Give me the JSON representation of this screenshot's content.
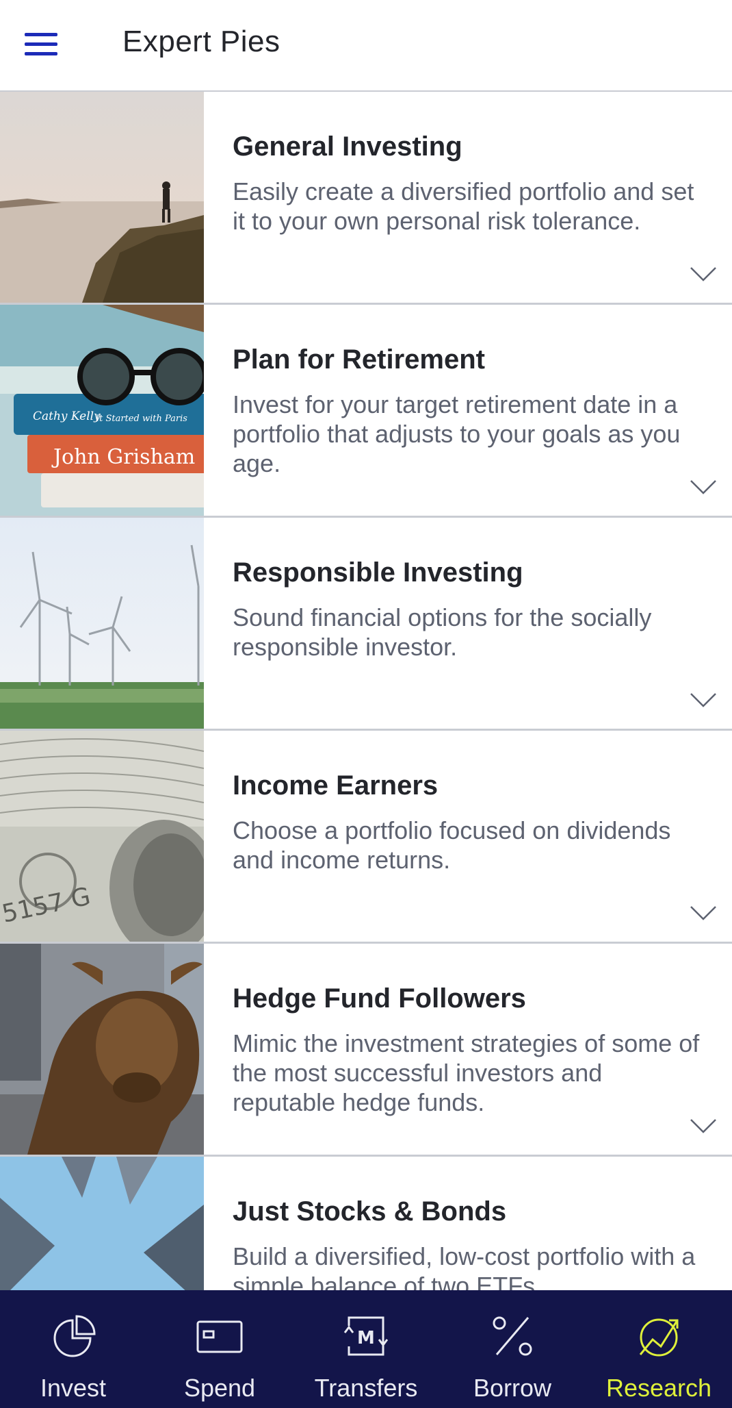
{
  "header": {
    "title": "Expert Pies"
  },
  "pies": [
    {
      "title": "General Investing",
      "description": "Easily create a diversified portfolio and set it to your own personal risk tolerance."
    },
    {
      "title": "Plan for Retirement",
      "description": "Invest for your target retirement date in a portfolio that adjusts to your goals as you age."
    },
    {
      "title": "Responsible Investing",
      "description": "Sound financial options for the socially responsible investor."
    },
    {
      "title": "Income Earners",
      "description": "Choose a portfolio focused on dividends and income returns."
    },
    {
      "title": "Hedge Fund Followers",
      "description": "Mimic the investment strategies of some of the most successful investors and reputable hedge funds."
    },
    {
      "title": "Just Stocks & Bonds",
      "description": "Build a diversified, low-cost portfolio with a simple balance of two ETFs."
    }
  ],
  "images": [
    {
      "icon": "hiker-on-cliff-image",
      "text": []
    },
    {
      "icon": "books-and-sunglasses-image",
      "text": [
        "Cathy Kelly",
        "It Started with Paris",
        "John Grisham"
      ]
    },
    {
      "icon": "wind-turbines-image",
      "text": []
    },
    {
      "icon": "dollar-bills-image",
      "text": [
        "5157 G"
      ]
    },
    {
      "icon": "bull-statue-image",
      "text": []
    },
    {
      "icon": "skyscrapers-image",
      "text": []
    }
  ],
  "tabs": [
    {
      "label": "Invest",
      "icon": "pie-chart-icon",
      "active": false
    },
    {
      "label": "Spend",
      "icon": "card-icon",
      "active": false
    },
    {
      "label": "Transfers",
      "icon": "transfer-icon",
      "active": false
    },
    {
      "label": "Borrow",
      "icon": "percent-icon",
      "active": false
    },
    {
      "label": "Research",
      "icon": "research-chart-icon",
      "active": true
    }
  ],
  "colors": {
    "accent": "#1c2bb8",
    "tabbar": "#13154a",
    "active_tab": "#dff03a"
  }
}
